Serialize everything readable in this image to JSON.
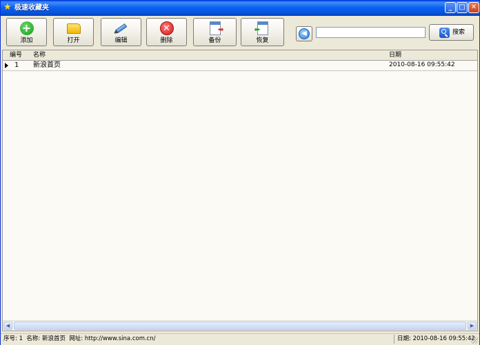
{
  "window": {
    "title": "极速收藏夹"
  },
  "toolbar": {
    "add": "添加",
    "open": "打开",
    "edit": "编辑",
    "delete": "删除",
    "backup": "备份",
    "restore": "恢复",
    "search_value": "",
    "search": "搜索"
  },
  "list": {
    "columns": {
      "no": "编号",
      "name": "名称",
      "date": "日期"
    },
    "rows": [
      {
        "no": "1",
        "name": "新浪首页",
        "date": "2010-08-16 09:55:42"
      }
    ]
  },
  "status": {
    "left": "序号: 1  名称: 新浪首页  网址: http://www.sina.com.cn/",
    "right": "日期: 2010-08-16 09:55:42"
  },
  "colors": {
    "titlebar": "#0a5fe8",
    "face": "#ece9d8",
    "list_bg": "#fbfaf5"
  }
}
